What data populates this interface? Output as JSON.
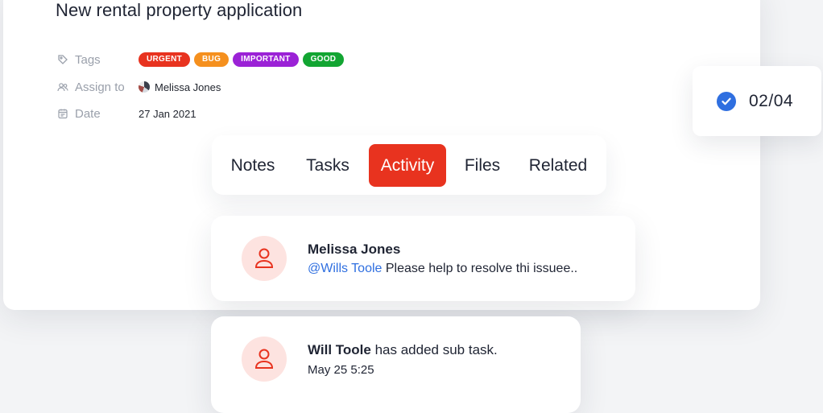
{
  "task": {
    "title": "New rental property application",
    "fields": {
      "tags_label": "Tags",
      "assign_label": "Assign to",
      "date_label": "Date",
      "assignee": "Melissa Jones",
      "date": "27 Jan 2021"
    },
    "tags": [
      {
        "label": "URGENT",
        "color": "#e8331f"
      },
      {
        "label": "BUG",
        "color": "#f5901e"
      },
      {
        "label": "IMPORTANT",
        "color": "#9b22d6"
      },
      {
        "label": "GOOD",
        "color": "#12a532"
      }
    ]
  },
  "counter": {
    "value": "02/04",
    "icon": "check-circle-icon",
    "color": "#2f6fe0"
  },
  "tabs": [
    {
      "label": "Notes",
      "active": false
    },
    {
      "label": "Tasks",
      "active": false
    },
    {
      "label": "Activity",
      "active": true
    },
    {
      "label": "Files",
      "active": false
    },
    {
      "label": "Related",
      "active": false
    }
  ],
  "activity": [
    {
      "name": "Melissa Jones",
      "mention": "@Wills Toole",
      "message": " Please help to resolve thi issuee.."
    },
    {
      "name": "Will Toole",
      "action": " has added sub task.",
      "time": "May 25 5:25"
    }
  ],
  "colors": {
    "accent": "#e8331f",
    "link": "#2f6fe0",
    "avatar_bg": "#fde3e0"
  }
}
